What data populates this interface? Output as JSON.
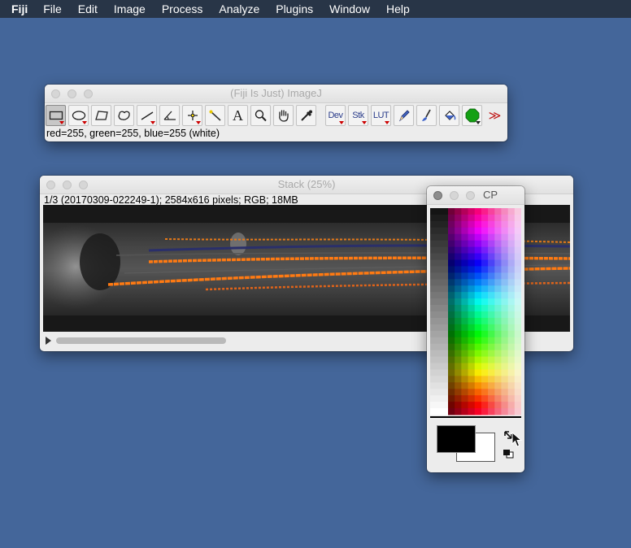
{
  "menubar": {
    "app": "Fiji",
    "items": [
      "File",
      "Edit",
      "Image",
      "Process",
      "Analyze",
      "Plugins",
      "Window",
      "Help"
    ]
  },
  "imagej_window": {
    "title": "(Fiji Is Just) ImageJ",
    "tools": [
      {
        "name": "rectangle-tool",
        "label": ""
      },
      {
        "name": "oval-tool",
        "label": ""
      },
      {
        "name": "polygon-tool",
        "label": ""
      },
      {
        "name": "freehand-tool",
        "label": ""
      },
      {
        "name": "line-tool",
        "label": ""
      },
      {
        "name": "angle-tool",
        "label": ""
      },
      {
        "name": "point-tool",
        "label": ""
      },
      {
        "name": "wand-tool",
        "label": ""
      },
      {
        "name": "text-tool",
        "label": "A"
      },
      {
        "name": "magnifier-tool",
        "label": ""
      },
      {
        "name": "hand-tool",
        "label": ""
      },
      {
        "name": "color-picker-tool",
        "label": ""
      },
      {
        "name": "dev-menu",
        "label": "Dev"
      },
      {
        "name": "stk-menu",
        "label": "Stk"
      },
      {
        "name": "lut-menu",
        "label": "LUT"
      },
      {
        "name": "pencil-tool",
        "label": ""
      },
      {
        "name": "brush-tool",
        "label": ""
      },
      {
        "name": "flood-fill-tool",
        "label": ""
      },
      {
        "name": "green-octagon-tool",
        "label": ""
      },
      {
        "name": "more-tools",
        "label": "≫"
      }
    ],
    "status": "red=255, green=255, blue=255 (white)"
  },
  "stack_window": {
    "title": "Stack (25%)",
    "info": "1/3 (20170309-022249-1); 2584x616 pixels; RGB; 18MB",
    "slice_position_fraction": 0
  },
  "cp_window": {
    "title": "CP",
    "foreground_color": "#000000",
    "background_color": "#ffffff"
  },
  "colors": {
    "desktop": "#44669a",
    "menubar": "#283547",
    "accent_orange": "#ff7a12"
  }
}
